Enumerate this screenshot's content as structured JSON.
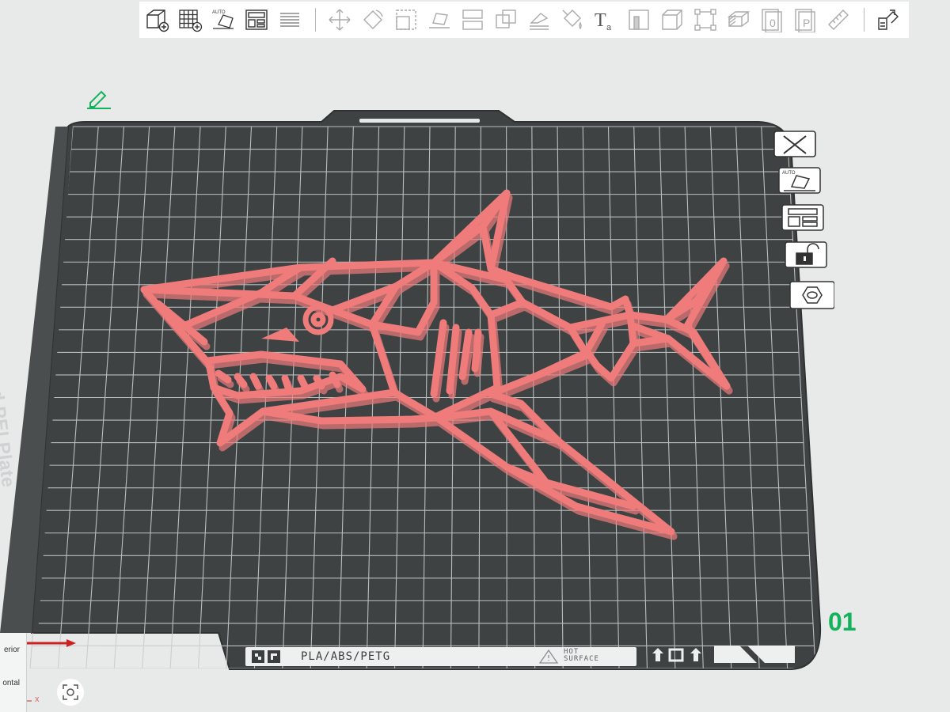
{
  "toolbar": {
    "items": [
      {
        "name": "add-object",
        "icon": "cube-plus-icon"
      },
      {
        "name": "add-plate",
        "icon": "grid-plus-icon"
      },
      {
        "name": "auto-orient",
        "icon": "auto-orient-icon"
      },
      {
        "name": "arrange",
        "icon": "arrange-icon"
      },
      {
        "name": "layers",
        "icon": "layers-icon"
      },
      {
        "name": "move",
        "icon": "move-icon"
      },
      {
        "name": "rotate",
        "icon": "rotate-icon"
      },
      {
        "name": "scale",
        "icon": "scale-icon"
      },
      {
        "name": "lay-on-face",
        "icon": "lay-on-face-icon"
      },
      {
        "name": "split",
        "icon": "split-icon"
      },
      {
        "name": "boolean",
        "icon": "boolean-icon"
      },
      {
        "name": "support-paint",
        "icon": "support-paint-icon"
      },
      {
        "name": "color-paint",
        "icon": "paint-bucket-icon"
      },
      {
        "name": "text",
        "icon": "text-icon"
      },
      {
        "name": "seam",
        "icon": "seam-icon"
      },
      {
        "name": "cut",
        "icon": "cut-icon"
      },
      {
        "name": "measure-box",
        "icon": "measure-box-icon"
      },
      {
        "name": "variable-layer",
        "icon": "variable-layer-icon"
      },
      {
        "name": "zero",
        "icon": "zero-icon"
      },
      {
        "name": "prime-tower",
        "icon": "prime-tower-icon"
      },
      {
        "name": "ruler",
        "icon": "ruler-icon"
      },
      {
        "name": "assembly",
        "icon": "assembly-icon"
      }
    ]
  },
  "plate": {
    "name": "Bambu Textured PEI Plate",
    "material": "PLA/ABS/PETG",
    "hot_surface_line1": "HOT",
    "hot_surface_line2": "SURFACE",
    "number": "01"
  },
  "side_buttons": [
    {
      "name": "delete-plate",
      "icon": "close-icon"
    },
    {
      "name": "auto-orient-plate",
      "icon": "auto-orient-icon"
    },
    {
      "name": "arrange-plate",
      "icon": "arrange-icon"
    },
    {
      "name": "lock-plate",
      "icon": "unlock-icon"
    },
    {
      "name": "plate-settings",
      "icon": "hexagon-settings-icon"
    }
  ],
  "view_panel": {
    "top_label": "erior",
    "bottom_label": "ontal",
    "axis_label": "x"
  },
  "colors": {
    "plate": "#3e4242",
    "grid": "#c8cccc",
    "model": "#ef7b7b",
    "model_shadow": "#b34a4a",
    "accent": "#12b35a",
    "axis_x": "#cc2222"
  }
}
